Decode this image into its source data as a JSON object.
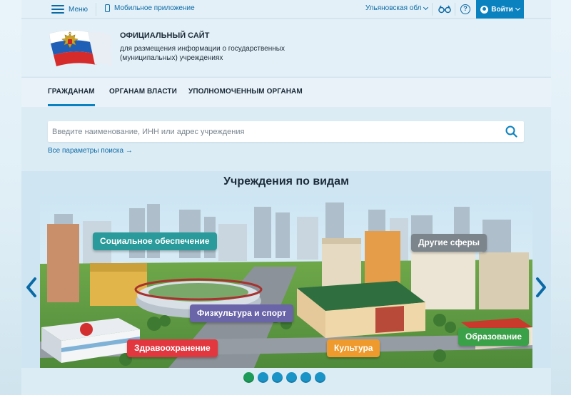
{
  "topbar": {
    "menu_label": "Меню",
    "mobile_label": "Мобильное приложение",
    "region": "Ульяновская обл",
    "login_label": "Войти",
    "help_glyph": "?"
  },
  "header": {
    "title": "ОФИЦИАЛЬНЫЙ САЙТ",
    "subtitle": "для размещения информации о государственных (муниципальных) учреждениях"
  },
  "nav": {
    "items": [
      {
        "label": "ГРАЖДАНАМ",
        "active": true
      },
      {
        "label": "ОРГАНАМ ВЛАСТИ",
        "active": false
      },
      {
        "label": "УПОЛНОМОЧЕННЫМ ОРГАНАМ",
        "active": false
      }
    ]
  },
  "search": {
    "placeholder": "Введите наименование, ИНН или адрес учреждения",
    "all_params": "Все параметры поиска →"
  },
  "banner": {
    "title": "Учреждения по видам",
    "categories": [
      {
        "label": "Социальное обеспечение",
        "color": "#2a9a9b"
      },
      {
        "label": "Другие сферы",
        "color": "#7c858c"
      },
      {
        "label": "Физкультура и спорт",
        "color": "#6a64a8"
      },
      {
        "label": "Здравоохранение",
        "color": "#e2373f"
      },
      {
        "label": "Культура",
        "color": "#ef9a2c"
      },
      {
        "label": "Образование",
        "color": "#3aa148"
      }
    ],
    "slides_total": 6,
    "active_slide": 1
  },
  "colors": {
    "accent": "#0b82c0",
    "link": "#0b6aa6"
  },
  "icons": [
    "hamburger-icon",
    "phone-icon",
    "chevron-down-icon",
    "glasses-icon",
    "help-icon",
    "user-icon",
    "search-icon",
    "arrow-left-icon",
    "arrow-right-icon",
    "coat-of-arms-logo"
  ]
}
